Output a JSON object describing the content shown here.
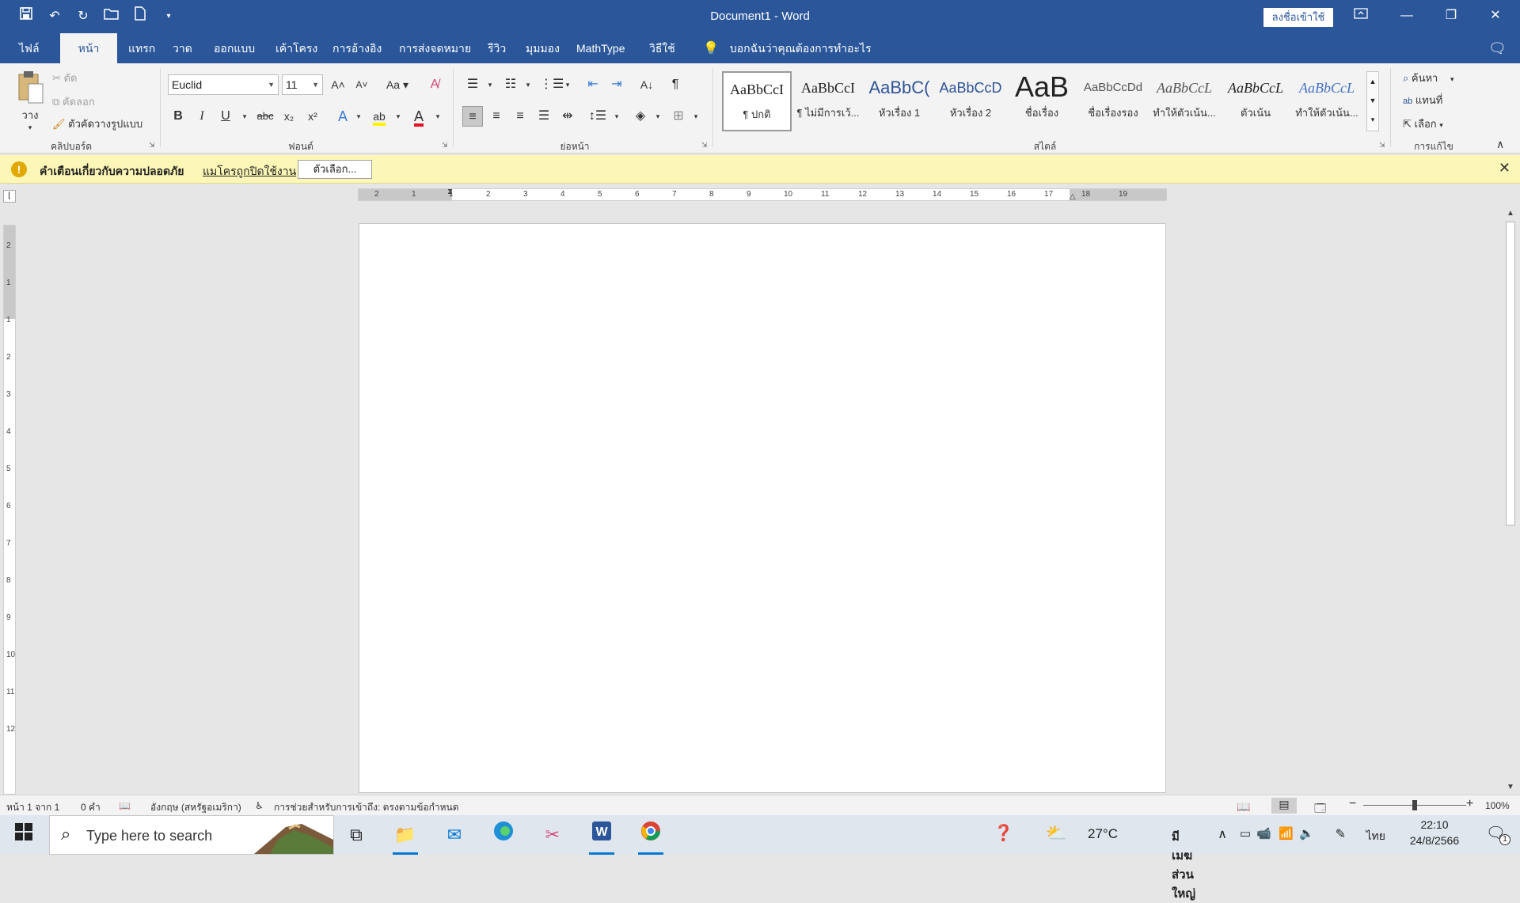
{
  "window": {
    "title": "Document1  -  Word",
    "signin_label": "ลงชื่อเข้าใช้"
  },
  "tabs": [
    "ไฟล์",
    "หน้าแรก",
    "แทรก",
    "วาด",
    "ออกแบบ",
    "เค้าโครง",
    "การอ้างอิง",
    "การส่งจดหมาย",
    "รีวิว",
    "มุมมอง",
    "MathType",
    "วิธีใช้"
  ],
  "tellme": "บอกฉันว่าคุณต้องการทำอะไร",
  "clipboard": {
    "paste": "วาง",
    "cut": "ตัด",
    "copy": "คัดลอก",
    "format_painter": "ตัวคัดวางรูปแบบ",
    "label": "คลิปบอร์ด"
  },
  "font": {
    "name": "Euclid",
    "size": "11",
    "case_label": "Aa",
    "label": "ฟอนต์"
  },
  "paragraph": {
    "label": "ย่อหน้า"
  },
  "styles": {
    "label": "สไตล์",
    "items": [
      {
        "preview": "AaBbCcI",
        "name": "¶ ปกติ"
      },
      {
        "preview": "AaBbCcI",
        "name": "¶ ไม่มีการเว้..."
      },
      {
        "preview": "AaBbC(",
        "name": "หัวเรื่อง 1"
      },
      {
        "preview": "AaBbCcD",
        "name": "หัวเรื่อง 2"
      },
      {
        "preview": "AaB",
        "name": "ชื่อเรื่อง"
      },
      {
        "preview": "AaBbCcDd",
        "name": "ชื่อเรื่องรอง"
      },
      {
        "preview": "AaBbCcL",
        "name": "ทำให้ตัวเน้น..."
      },
      {
        "preview": "AaBbCcL",
        "name": "ตัวเน้น"
      },
      {
        "preview": "AaBbCcL",
        "name": "ทำให้ตัวเน้น..."
      }
    ]
  },
  "editing": {
    "find": "ค้นหา",
    "replace": "แทนที่",
    "select": "เลือก",
    "label": "การแก้ไข"
  },
  "security": {
    "title": "คำเตือนเกี่ยวกับความปลอดภัย",
    "message": "แมโครถูกปิดใช้งาน",
    "button": "ตัวเลือก..."
  },
  "ruler": {
    "h_ticks": [
      "2",
      "1",
      "1",
      "2",
      "3",
      "4",
      "5",
      "6",
      "7",
      "8",
      "9",
      "10",
      "11",
      "12",
      "13",
      "14",
      "15",
      "16",
      "17",
      "18",
      "19"
    ],
    "v_ticks": [
      "2",
      "1",
      "1",
      "2",
      "3",
      "4",
      "5",
      "6",
      "7",
      "8",
      "9",
      "10",
      "11",
      "12"
    ]
  },
  "status": {
    "page": "หน้า 1 จาก 1",
    "words": "0 คำ",
    "language": "อังกฤษ (สหรัฐอเมริกา)",
    "accessibility": "การช่วยสำหรับการเข้าถึง: ตรงตามข้อกำหนด",
    "zoom": "100%",
    "zoom_fraction": 0.5
  },
  "taskbar": {
    "search_placeholder": "Type here to search",
    "weather": "27°C",
    "weather_desc": "มีเมฆส่วนใหญ่",
    "lang": "ไทย",
    "time": "22:10",
    "date": "24/8/2566",
    "notifications": "1"
  },
  "colors": {
    "word_blue": "#2b579a",
    "warning_bar": "#fcf7b6",
    "font_color": "#e81123",
    "highlight": "#fff200"
  }
}
